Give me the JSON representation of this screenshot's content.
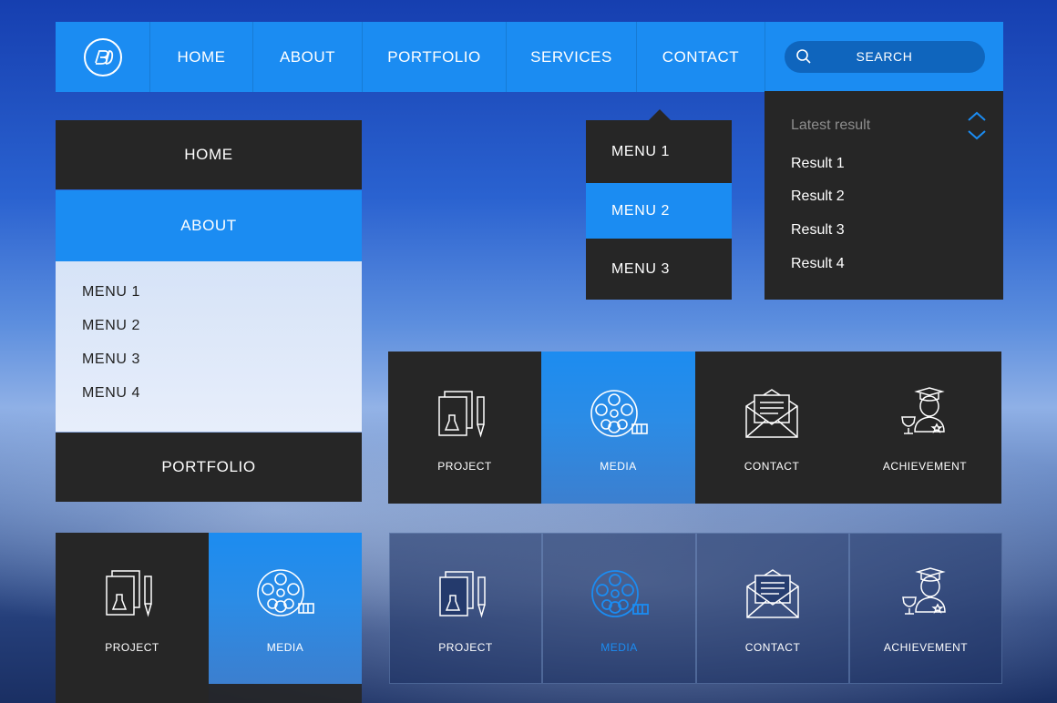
{
  "colors": {
    "accent": "#1b8cf2",
    "dark_panel": "#262626",
    "muted_text": "#8d8d8d",
    "light_panel": "#e2eaf9"
  },
  "navbar": {
    "logo_icon": "brand-logo-icon",
    "items": [
      "HOME",
      "ABOUT",
      "PORTFOLIO",
      "SERVICES",
      "CONTACT"
    ],
    "search_label": "SEARCH",
    "search_icon": "search-icon"
  },
  "side_menu": {
    "items": [
      "HOME",
      "ABOUT",
      "PORTFOLIO"
    ],
    "active": "ABOUT",
    "submenu": [
      "MENU 1",
      "MENU 2",
      "MENU 3",
      "MENU 4"
    ]
  },
  "dropdown": {
    "items": [
      "MENU 1",
      "MENU 2",
      "MENU 3"
    ],
    "active": "MENU 2"
  },
  "results": {
    "heading": "Latest result",
    "items": [
      "Result 1",
      "Result 2",
      "Result 3",
      "Result 4"
    ],
    "arrow_icons": [
      "chevron-up-icon",
      "chevron-down-icon"
    ]
  },
  "tiles_row1": [
    {
      "label": "PROJECT",
      "icon": "project-icon",
      "active": false
    },
    {
      "label": "MEDIA",
      "icon": "film-reel-icon",
      "active": true
    },
    {
      "label": "CONTACT",
      "icon": "envelope-icon",
      "active": false
    },
    {
      "label": "ACHIEVEMENT",
      "icon": "achievement-icon",
      "active": false
    }
  ],
  "tiles_row2_left": [
    {
      "label": "PROJECT",
      "icon": "project-icon",
      "active": false
    },
    {
      "label": "MEDIA",
      "icon": "film-reel-icon",
      "active": true
    }
  ],
  "tiles_row2_right": [
    {
      "label": "PROJECT",
      "icon": "project-icon",
      "active": false
    },
    {
      "label": "MEDIA",
      "icon": "film-reel-icon",
      "active": true
    },
    {
      "label": "CONTACT",
      "icon": "envelope-icon",
      "active": false
    },
    {
      "label": "ACHIEVEMENT",
      "icon": "achievement-icon",
      "active": false
    }
  ]
}
